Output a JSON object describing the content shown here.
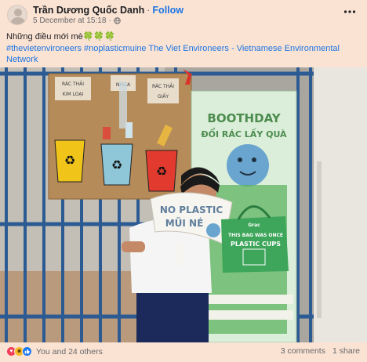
{
  "post": {
    "author": "Trần Dương Quốc Danh",
    "separator": "·",
    "follow_label": "Follow",
    "timestamp": "5 December at 15:18",
    "meta_separator": "·",
    "audience_icon": "globe-icon",
    "caption_text": "Những điều mới mè",
    "caption_emoji": "🍀🍀🍀",
    "caption_tags": "#thevietenvironeers #noplasticmuine The Viet Environeers - Vietnamese Environmental Network"
  },
  "photo": {
    "bins": [
      "RÁC THẢI KIM LOẠI",
      "NHỰA",
      "RÁC THẢI GIẤY"
    ],
    "poster_title": "BOOTHDAY",
    "poster_subtitle": "ĐỔI RÁC LẤY QUÀ",
    "sign_text": "NO PLASTIC MŨI NÉ",
    "bag_brand": "Grac",
    "bag_text": "THIS BAG WAS ONCE PLASTIC CUPS"
  },
  "footer": {
    "reaction_icons": [
      "love-icon",
      "haha-icon",
      "like-icon"
    ],
    "reactions_label": "You and 24 others",
    "comments_label": "3 comments",
    "shares_label": "1 share"
  },
  "colors": {
    "background": "#fbe3d3",
    "link": "#1b74e4",
    "secondary_text": "#65676b",
    "love": "#f33e58",
    "haha": "#f7b928",
    "like": "#1877f2"
  }
}
